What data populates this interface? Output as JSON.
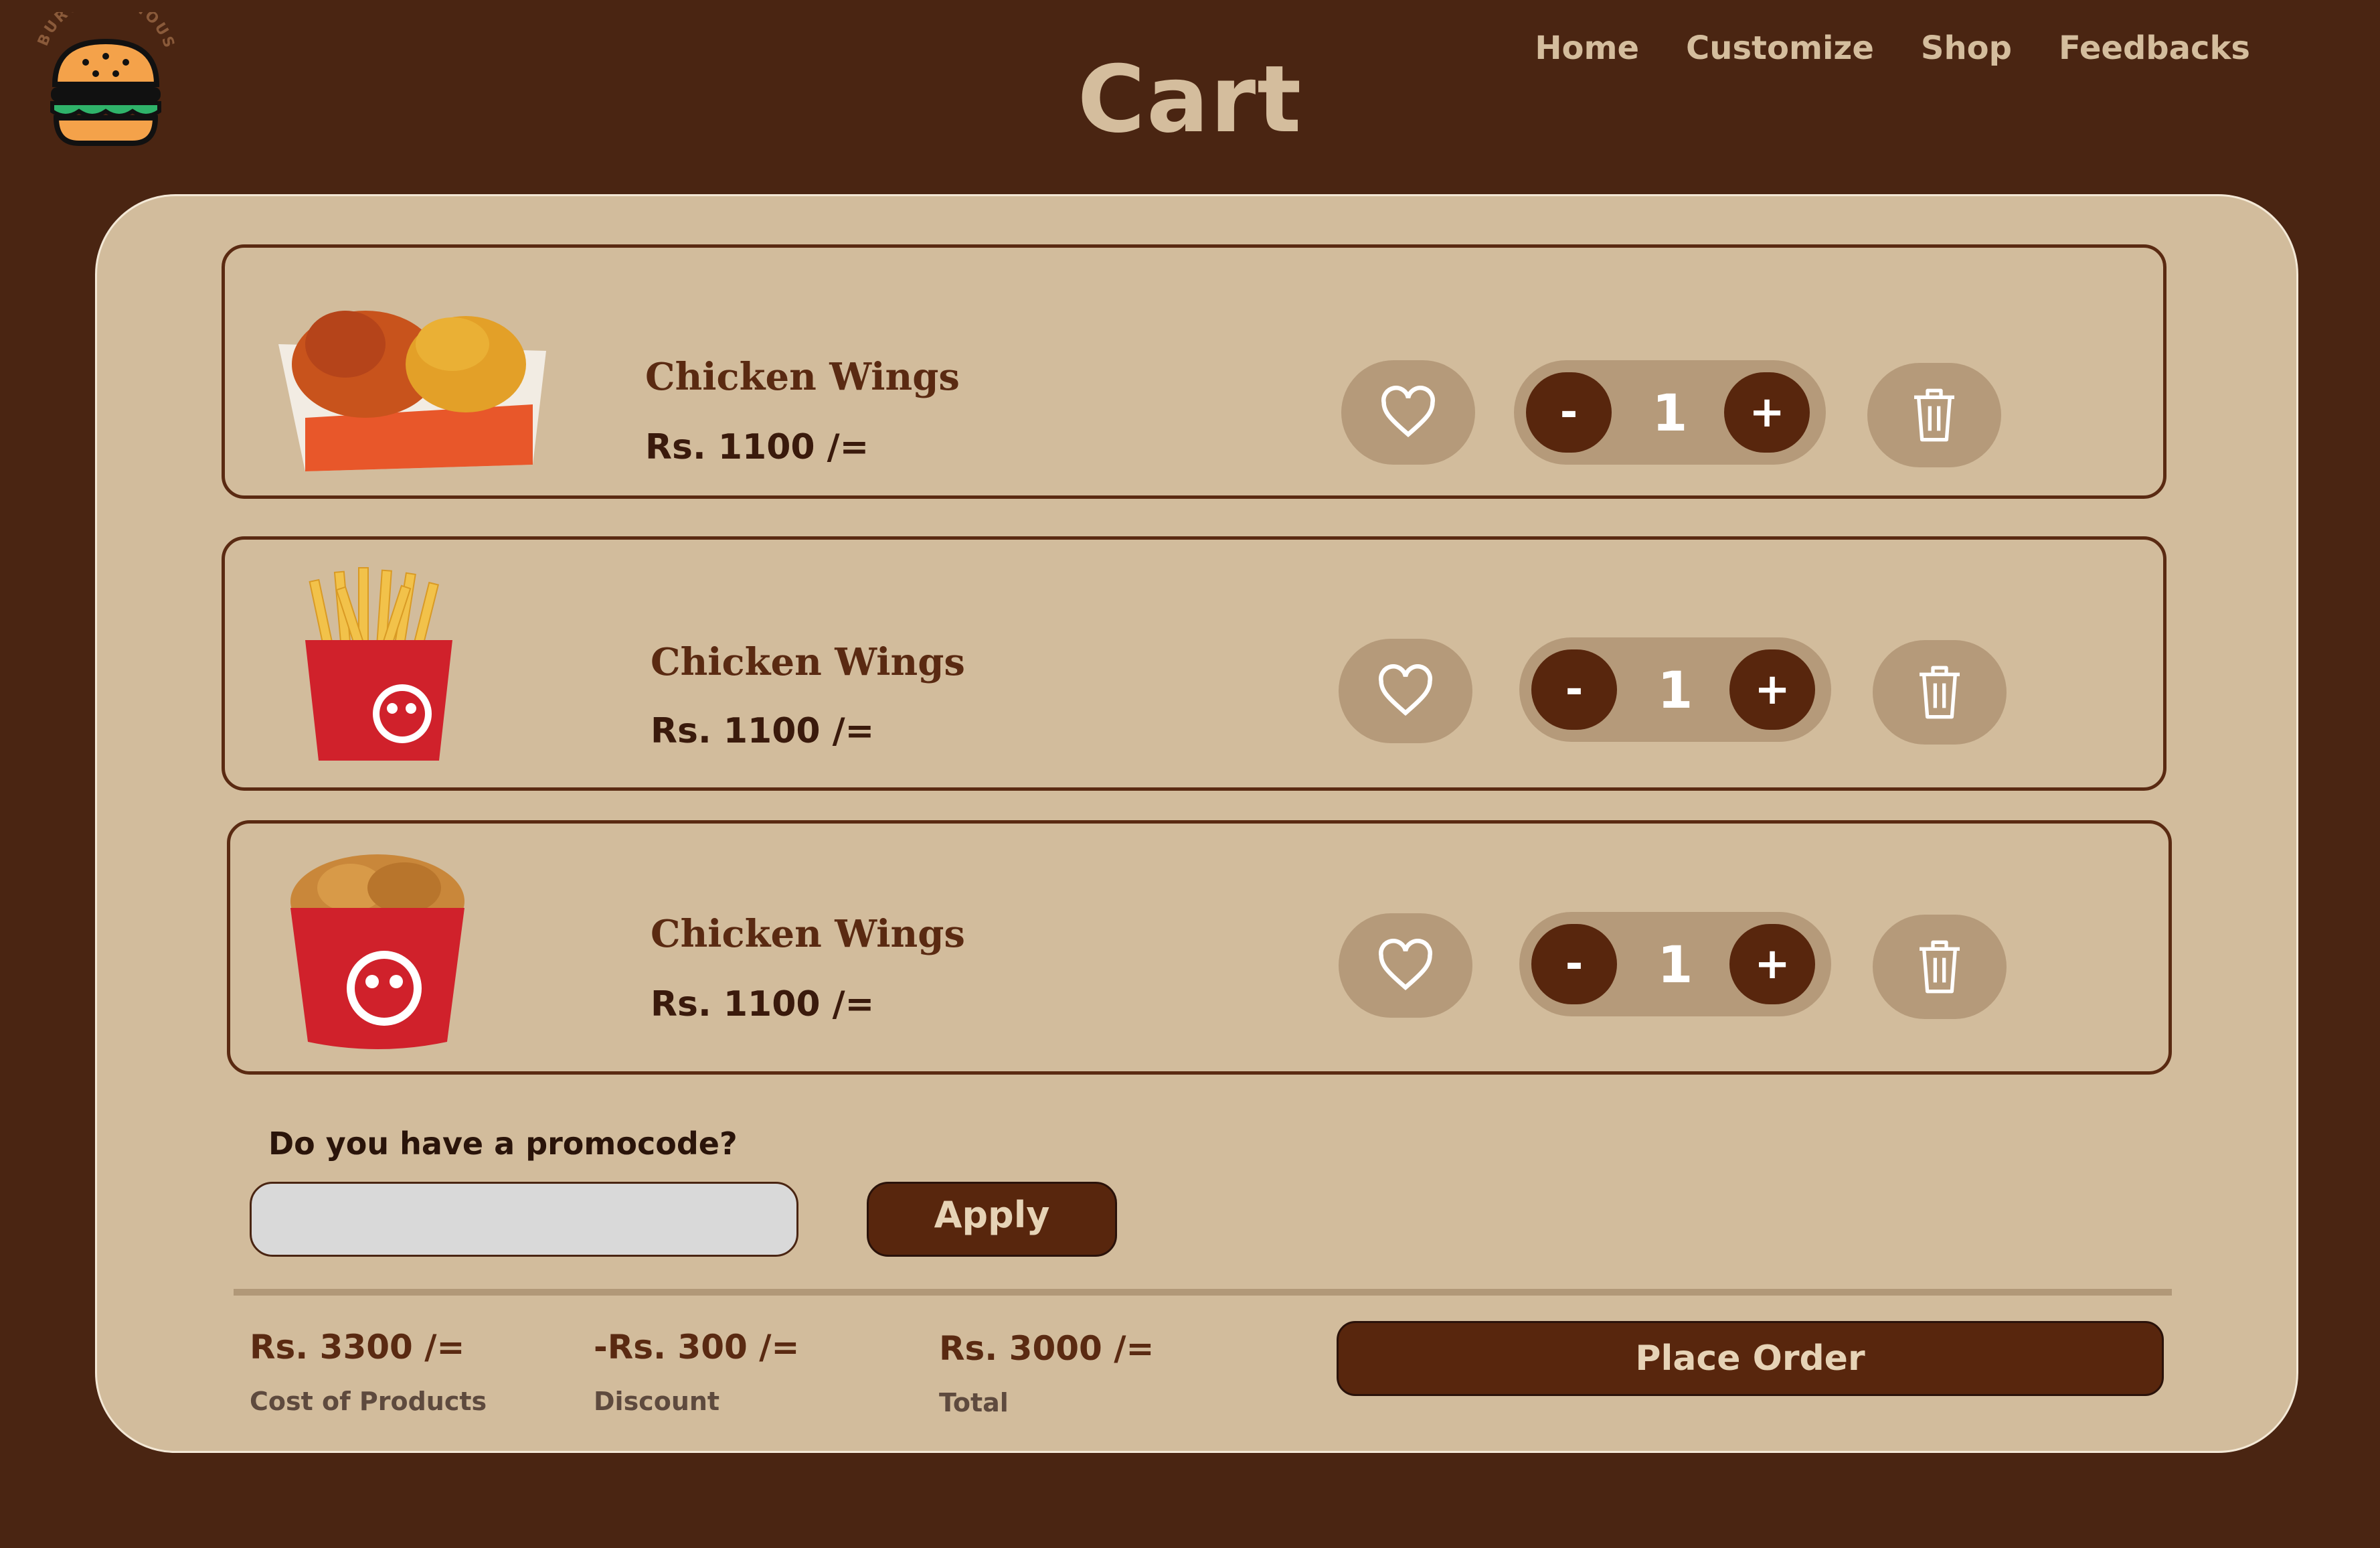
{
  "brand": {
    "logo_text": "BURGERLICIOUS"
  },
  "header": {
    "title": "Cart"
  },
  "nav": {
    "items": [
      "Home",
      "Customize",
      "Shop",
      "Feedbacks"
    ]
  },
  "cart": {
    "items": [
      {
        "name": "Chicken Wings",
        "price": "Rs. 1100 /=",
        "quantity": "1",
        "image": "chicken-box"
      },
      {
        "name": "Chicken Wings",
        "price": "Rs. 1100 /=",
        "quantity": "1",
        "image": "fries"
      },
      {
        "name": "Chicken Wings",
        "price": "Rs. 1100 /=",
        "quantity": "1",
        "image": "chicken-bucket"
      }
    ],
    "minus_label": "-",
    "plus_label": "+"
  },
  "promo": {
    "label": "Do you have a promocode?",
    "value": "",
    "placeholder": "",
    "apply_label": "Apply"
  },
  "summary": {
    "cost": {
      "value": "Rs. 3300 /=",
      "label": "Cost of Products"
    },
    "discount": {
      "value": "-Rs. 300 /=",
      "label": "Discount"
    },
    "total": {
      "value": "Rs. 3000 /=",
      "label": "Total"
    },
    "place_order_label": "Place Order"
  },
  "colors": {
    "background": "#4a2512",
    "panel": "#d2bc9c",
    "accent": "#58260d",
    "button_soft": "#b59a7a",
    "title": "#d4bd9d"
  }
}
